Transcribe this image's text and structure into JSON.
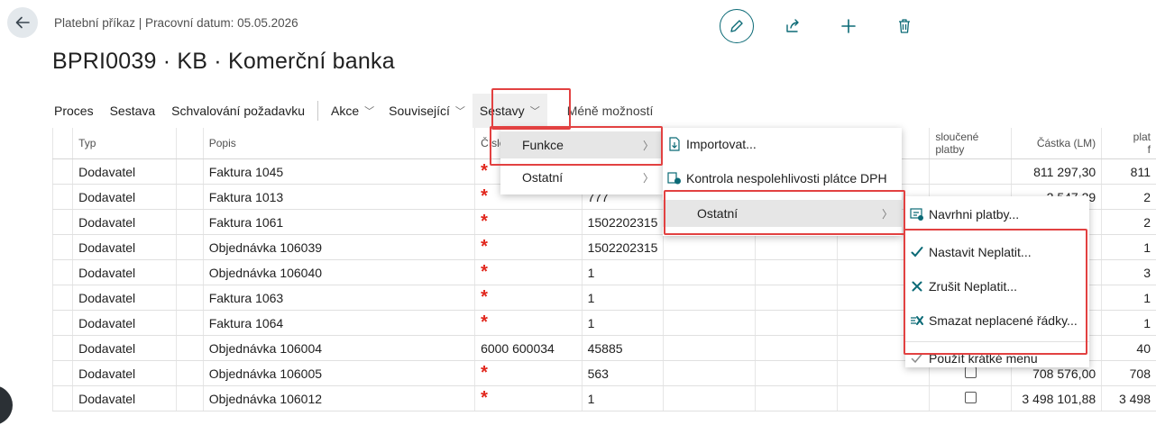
{
  "header": {
    "breadcrumb": "Platební příkaz | Pracovní datum: 05.05.2026",
    "title": "BPRI0039 · KB · Komerční banka",
    "icons": [
      "edit-icon",
      "share-icon",
      "add-icon",
      "delete-icon"
    ]
  },
  "actionbar": {
    "items": [
      "Proces",
      "Sestava",
      "Schvalování požadavku",
      "Akce",
      "Související",
      "Sestavy",
      "Méně možností"
    ]
  },
  "table": {
    "headers": {
      "typ": "Typ",
      "popis": "Popis",
      "cislo": "Číslo účt",
      "slouc1": "sloučené",
      "slouc2": "platby",
      "castka": "Částka (LM)",
      "plat1": "plat",
      "plat2": "f"
    },
    "rows": [
      {
        "typ": "Dodavatel",
        "popis": "Faktura 1045",
        "acct": "",
        "req": true,
        "c4": "",
        "checkbox": false,
        "amount": "811 297,30",
        "last": "811"
      },
      {
        "typ": "Dodavatel",
        "popis": "Faktura 1013",
        "acct": "",
        "req": true,
        "c4": "777",
        "checkbox": false,
        "amount": "2 547,29",
        "last": "2"
      },
      {
        "typ": "Dodavatel",
        "popis": "Faktura 1061",
        "acct": "",
        "req": true,
        "c4": "1502202315",
        "checkbox": false,
        "amount": "",
        "last": "2"
      },
      {
        "typ": "Dodavatel",
        "popis": "Objednávka 106039",
        "acct": "",
        "req": true,
        "c4": "1502202315",
        "checkbox": true,
        "amount": "",
        "last": "1"
      },
      {
        "typ": "Dodavatel",
        "popis": "Objednávka 106040",
        "acct": "",
        "req": true,
        "c4": "1",
        "checkbox": true,
        "amount": "",
        "last": "3"
      },
      {
        "typ": "Dodavatel",
        "popis": "Faktura 1063",
        "acct": "",
        "req": true,
        "c4": "1",
        "checkbox": true,
        "amount": "",
        "last": "1"
      },
      {
        "typ": "Dodavatel",
        "popis": "Faktura 1064",
        "acct": "",
        "req": true,
        "c4": "1",
        "checkbox": true,
        "amount": "",
        "last": "1"
      },
      {
        "typ": "Dodavatel",
        "popis": "Objednávka 106004",
        "acct": "6000 600034",
        "req": false,
        "c4": "45885",
        "checkbox": true,
        "amount": "",
        "last": "40"
      },
      {
        "typ": "Dodavatel",
        "popis": "Objednávka 106005",
        "acct": "",
        "req": true,
        "c4": "563",
        "checkbox": true,
        "amount": "708 576,00",
        "last": "708"
      },
      {
        "typ": "Dodavatel",
        "popis": "Objednávka 106012",
        "acct": "",
        "req": true,
        "c4": "1",
        "checkbox": true,
        "amount": "3 498 101,88",
        "last": "3 498"
      }
    ]
  },
  "menu1": {
    "items": [
      "Funkce",
      "Ostatní"
    ]
  },
  "menu2": {
    "items": [
      "Importovat...",
      "Kontrola nespolehlivosti plátce DPH",
      "Ostatní"
    ]
  },
  "menu3": {
    "items": [
      "Navrhni platby...",
      "Nastavit Neplatit...",
      "Zrušit Neplatit...",
      "Smazat neplacené řádky...",
      "Použít krátké menu"
    ]
  },
  "colors": {
    "accent": "#0b6a76",
    "highlight": "#e24141",
    "required": "#e1261c"
  }
}
